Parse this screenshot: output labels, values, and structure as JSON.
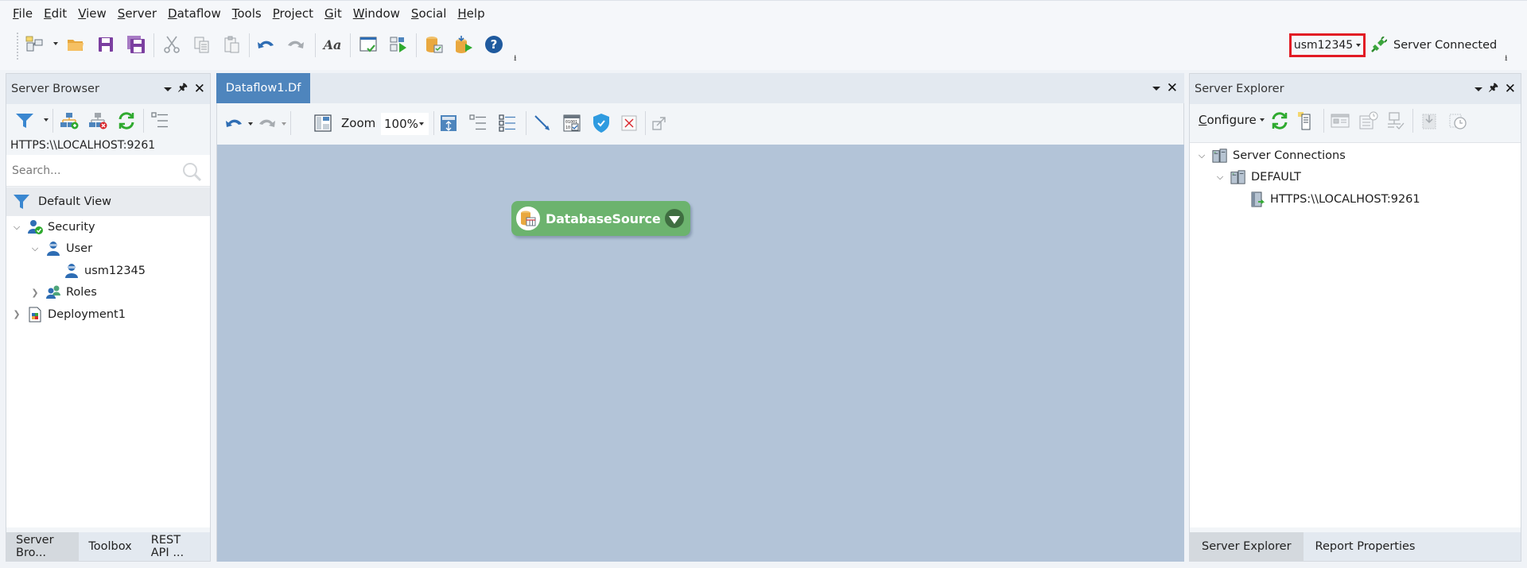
{
  "menubar": {
    "items": [
      {
        "accel": "F",
        "rest": "ile"
      },
      {
        "accel": "E",
        "rest": "dit"
      },
      {
        "accel": "V",
        "rest": "iew"
      },
      {
        "accel": "S",
        "rest": "erver"
      },
      {
        "accel": "D",
        "rest": "ataflow"
      },
      {
        "accel": "T",
        "rest": "ools"
      },
      {
        "accel": "P",
        "rest": "roject"
      },
      {
        "accel": "G",
        "rest": "it"
      },
      {
        "accel": "W",
        "rest": "indow"
      },
      {
        "accel": "S",
        "rest": "ocial"
      },
      {
        "accel": "H",
        "rest": "elp"
      }
    ]
  },
  "toolbar": {
    "icons": [
      "new-project-icon",
      "open-folder-icon",
      "save-icon",
      "save-all-icon",
      "cut-icon",
      "copy-icon",
      "paste-icon",
      "undo-icon",
      "redo-icon",
      "font-icon",
      "verify-icon",
      "run-dataflow-icon",
      "database-icon",
      "deploy-run-icon",
      "help-icon"
    ],
    "user": "usm12345",
    "server_status": "Server Connected",
    "colors": {
      "highlight_box": "#e21b24",
      "accent": "#4e85bd",
      "node_green": "#6cb36e"
    }
  },
  "left_panel": {
    "title": "Server Browser",
    "server_url": "HTTPS:\\\\LOCALHOST:9261",
    "search_placeholder": "Search...",
    "default_view": "Default View",
    "tree": [
      {
        "label": "Security",
        "level": 0,
        "expanded": true,
        "icon": "security-icon"
      },
      {
        "label": "User",
        "level": 1,
        "expanded": true,
        "icon": "user-icon"
      },
      {
        "label": "usm12345",
        "level": 2,
        "icon": "user-icon"
      },
      {
        "label": "Roles",
        "level": 1,
        "expanded": false,
        "icon": "roles-icon"
      },
      {
        "label": "Deployment1",
        "level": 0,
        "expanded": false,
        "icon": "deployment-icon"
      }
    ],
    "bottom_tabs": [
      {
        "label": "Server Bro...",
        "active": true
      },
      {
        "label": "Toolbox",
        "active": false
      },
      {
        "label": "REST API ...",
        "active": false
      }
    ]
  },
  "center": {
    "tab": "Dataflow1.Df",
    "zoom_label": "Zoom",
    "zoom_value": "100%",
    "node": {
      "label": "DatabaseSource"
    }
  },
  "right_panel": {
    "title": "Server Explorer",
    "configure_accel": "C",
    "configure_rest": "onfigure",
    "tree": [
      {
        "label": "Server Connections",
        "level": 0,
        "expanded": true
      },
      {
        "label": "DEFAULT",
        "level": 1,
        "expanded": true
      },
      {
        "label": "HTTPS:\\\\LOCALHOST:9261",
        "level": 2
      }
    ],
    "bottom_tabs": [
      {
        "label": "Server Explorer",
        "active": true
      },
      {
        "label": "Report Properties",
        "active": false
      }
    ]
  }
}
